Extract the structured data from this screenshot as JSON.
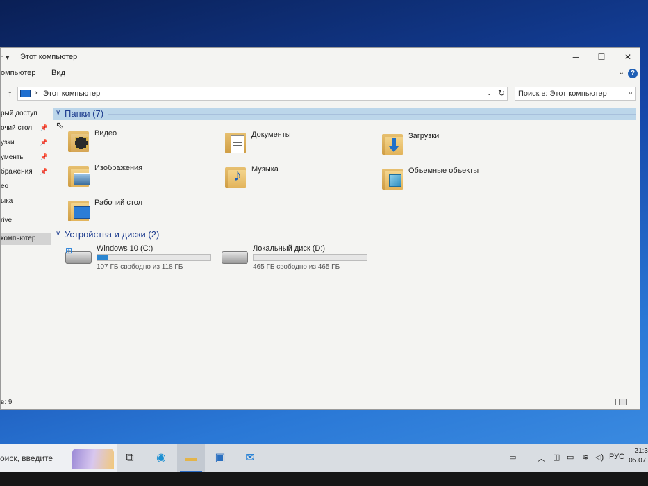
{
  "window": {
    "title": "Этот компьютер",
    "quick_access_glyph": "▫ ▾",
    "controls": {
      "minimize": "─",
      "maximize": "☐",
      "close": "✕"
    }
  },
  "ribbon": {
    "tabs": [
      "омпьютер",
      "Вид"
    ],
    "collapse": "⌄",
    "help": "?"
  },
  "address": {
    "up": "↑",
    "path": "Этот компьютер",
    "separator": "›",
    "dropdown": "⌄",
    "refresh": "↻"
  },
  "search": {
    "placeholder": "Поиск в: Этот компьютер",
    "icon": "search-icon"
  },
  "nav": {
    "items": [
      {
        "label": "рый доступ",
        "pinned": false
      },
      {
        "label": "очий стол",
        "pinned": true
      },
      {
        "label": "узки",
        "pinned": true
      },
      {
        "label": "ументы",
        "pinned": true
      },
      {
        "label": "бражения",
        "pinned": true
      },
      {
        "label": "ео",
        "pinned": false
      },
      {
        "label": "ыка",
        "pinned": false
      },
      {
        "label": "rive",
        "pinned": false
      },
      {
        "label": "компьютер",
        "pinned": false,
        "selected": true
      }
    ],
    "pin_glyph": "📌"
  },
  "groups": {
    "folders": {
      "title": "Папки (7)",
      "items": [
        {
          "name": "Видео",
          "icon": "video-folder-icon"
        },
        {
          "name": "Документы",
          "icon": "documents-folder-icon"
        },
        {
          "name": "Загрузки",
          "icon": "downloads-folder-icon"
        },
        {
          "name": "Изображения",
          "icon": "pictures-folder-icon"
        },
        {
          "name": "Музыка",
          "icon": "music-folder-icon"
        },
        {
          "name": "Объемные объекты",
          "icon": "3d-objects-folder-icon"
        },
        {
          "name": "Рабочий стол",
          "icon": "desktop-folder-icon"
        }
      ]
    },
    "drives": {
      "title": "Устройства и диски (2)",
      "items": [
        {
          "name": "Windows 10 (C:)",
          "free": "107 ГБ свободно из 118 ГБ",
          "used_fraction": 0.09,
          "system": true
        },
        {
          "name": "Локальный диск (D:)",
          "free": "465 ГБ свободно из 465 ГБ",
          "used_fraction": 0.0,
          "system": false
        }
      ]
    }
  },
  "status": {
    "count": "в: 9"
  },
  "taskbar": {
    "search_placeholder": "оиск, введите",
    "apps": [
      "task-view-icon",
      "edge-icon",
      "file-explorer-icon",
      "store-icon",
      "mail-icon"
    ],
    "tray": {
      "language": "РУС",
      "time": "21:3",
      "date": "05.07."
    }
  },
  "colors": {
    "accent": "#2b86d1",
    "group_header": "#1e3d8f",
    "selection": "#bcd6ea"
  }
}
